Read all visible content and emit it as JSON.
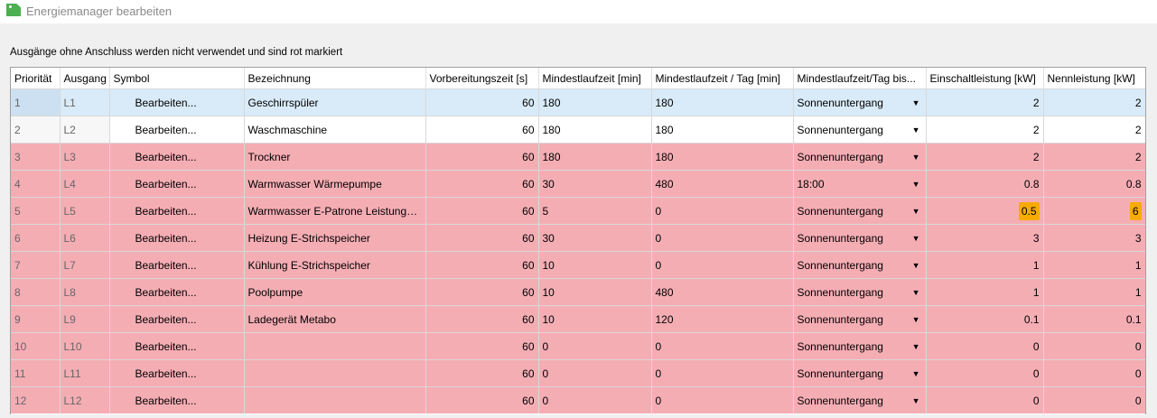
{
  "window": {
    "title": "Energiemanager bearbeiten"
  },
  "notice": "Ausgänge ohne Anschluss werden nicht verwendet und sind rot markiert",
  "columns": [
    "Priorität",
    "Ausgang",
    "Symbol",
    "Bezeichnung",
    "Vorbereitungszeit [s]",
    "Mindestlaufzeit [min]",
    "Mindestlaufzeit / Tag [min]",
    "Mindestlaufzeit/Tag bis...",
    "Einschaltleistung [kW]",
    "Nennleistung [kW]"
  ],
  "colors": {
    "unconnected": "#f5adb4",
    "selected": "#d9ebf9",
    "highlight": "#f7aa00"
  },
  "rows": [
    {
      "prio": "1",
      "out": "L1",
      "symbol": "Bearbeiten...",
      "name": "Geschirrspüler",
      "prep": "60",
      "min": "180",
      "minday": "180",
      "until": "Sonnenuntergang",
      "on": "2",
      "nom": "2",
      "state": "selected"
    },
    {
      "prio": "2",
      "out": "L2",
      "symbol": "Bearbeiten...",
      "name": "Waschmaschine",
      "prep": "60",
      "min": "180",
      "minday": "180",
      "until": "Sonnenuntergang",
      "on": "2",
      "nom": "2",
      "state": "connected"
    },
    {
      "prio": "3",
      "out": "L3",
      "symbol": "Bearbeiten...",
      "name": "Trockner",
      "prep": "60",
      "min": "180",
      "minday": "180",
      "until": "Sonnenuntergang",
      "on": "2",
      "nom": "2",
      "state": "unconnected"
    },
    {
      "prio": "4",
      "out": "L4",
      "symbol": "Bearbeiten...",
      "name": "Warmwasser Wärmepumpe",
      "prep": "60",
      "min": "30",
      "minday": "480",
      "until": "18:00",
      "on": "0.8",
      "nom": "0.8",
      "state": "unconnected"
    },
    {
      "prio": "5",
      "out": "L5",
      "symbol": "Bearbeiten...",
      "name": "Warmwasser E-Patrone Leistungss...",
      "prep": "60",
      "min": "5",
      "minday": "0",
      "until": "Sonnenuntergang",
      "on": "0.5",
      "nom": "6",
      "state": "unconnected",
      "highlight": true
    },
    {
      "prio": "6",
      "out": "L6",
      "symbol": "Bearbeiten...",
      "name": "Heizung  E-Strichspeicher",
      "prep": "60",
      "min": "30",
      "minday": "0",
      "until": "Sonnenuntergang",
      "on": "3",
      "nom": "3",
      "state": "unconnected"
    },
    {
      "prio": "7",
      "out": "L7",
      "symbol": "Bearbeiten...",
      "name": "Kühlung E-Strichspeicher",
      "prep": "60",
      "min": "10",
      "minday": "0",
      "until": "Sonnenuntergang",
      "on": "1",
      "nom": "1",
      "state": "unconnected"
    },
    {
      "prio": "8",
      "out": "L8",
      "symbol": "Bearbeiten...",
      "name": "Poolpumpe",
      "prep": "60",
      "min": "10",
      "minday": "480",
      "until": "Sonnenuntergang",
      "on": "1",
      "nom": "1",
      "state": "unconnected"
    },
    {
      "prio": "9",
      "out": "L9",
      "symbol": "Bearbeiten...",
      "name": "Ladegerät Metabo",
      "prep": "60",
      "min": "10",
      "minday": "120",
      "until": "Sonnenuntergang",
      "on": "0.1",
      "nom": "0.1",
      "state": "unconnected"
    },
    {
      "prio": "10",
      "out": "L10",
      "symbol": "Bearbeiten...",
      "name": "",
      "prep": "60",
      "min": "0",
      "minday": "0",
      "until": "Sonnenuntergang",
      "on": "0",
      "nom": "0",
      "state": "unconnected"
    },
    {
      "prio": "11",
      "out": "L11",
      "symbol": "Bearbeiten...",
      "name": "",
      "prep": "60",
      "min": "0",
      "minday": "0",
      "until": "Sonnenuntergang",
      "on": "0",
      "nom": "0",
      "state": "unconnected"
    },
    {
      "prio": "12",
      "out": "L12",
      "symbol": "Bearbeiten...",
      "name": "",
      "prep": "60",
      "min": "0",
      "minday": "0",
      "until": "Sonnenuntergang",
      "on": "0",
      "nom": "0",
      "state": "unconnected"
    }
  ]
}
